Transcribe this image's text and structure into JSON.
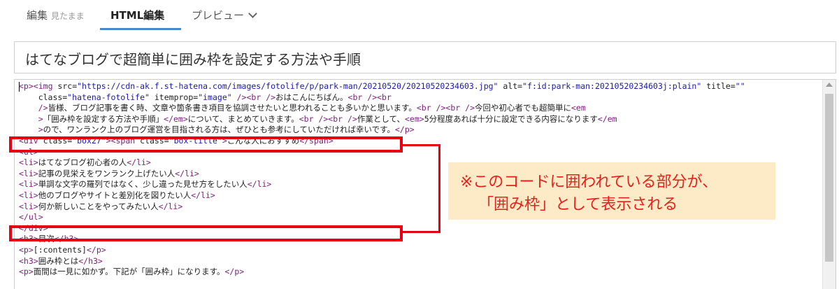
{
  "tabs": [
    {
      "label": "編集",
      "sublabel": "見たまま",
      "active": false
    },
    {
      "label": "HTML編集",
      "active": true
    },
    {
      "label": "プレビュー",
      "icon": "chevron-down-icon",
      "active": false
    }
  ],
  "title_input": {
    "value": "はてなブログで超簡単に囲み枠を設定する方法や手順"
  },
  "code_lines": [
    "<p><img src=\"https://cdn-ak.f.st-hatena.com/images/fotolife/p/park-man/20210520/20210520234603.jpg\" alt=\"f:id:park-man:20210520234603j:plain\" title=\"\"",
    "    class=\"hatena-fotolife\" itemprop=\"image\" /><br />おはこんにちばん。<br /><br",
    "    />皆様、ブログ記事を書く時、文章や箇条書き項目を協調させたいと思われることも多いかと思います。<br /><br />今回や初心者でも超簡単に<em",
    "    >「囲み枠を設定する方法や手順」</em>について、まとめていきます。<br /><br />作業として、<em>5分程度あれば十分に設定できる内容になります</em",
    "    >ので、ワンランク上のブログ運営を目指される方は、ぜひとも参考にしていただければ幸いです。</p>",
    "<div class=\"box27\"><span class=\"box-title\">こんな人におすすめ</span>",
    "<ul>",
    "<li>はてなブログ初心者の人</li>",
    "<li>記事の見栄えをワンランク上げたい人</li>",
    "<li>単調な文字の羅列ではなく、少し違った見せ方をしたい人</li>",
    "<li>他のブログやサイトと差別化を図りたい人</li>",
    "<li>何か新しいことをやってみたい人</li>",
    "</ul>",
    "</div>",
    "<h3>目次</h3>",
    "<p>[:contents]</p>",
    "<h3>囲み枠とは</h3>",
    "<p>面間は一見に如かず。下記が「囲み枠」になります。</p>"
  ],
  "annotation": {
    "line1": "※このコードに囲われている部分が、",
    "line2": "「囲み枠」として表示される"
  },
  "colors": {
    "highlight": "#e60012",
    "note_bg": "#fdebc8",
    "note_text": "#e8201b",
    "tab_accent": "#4a87c8"
  }
}
